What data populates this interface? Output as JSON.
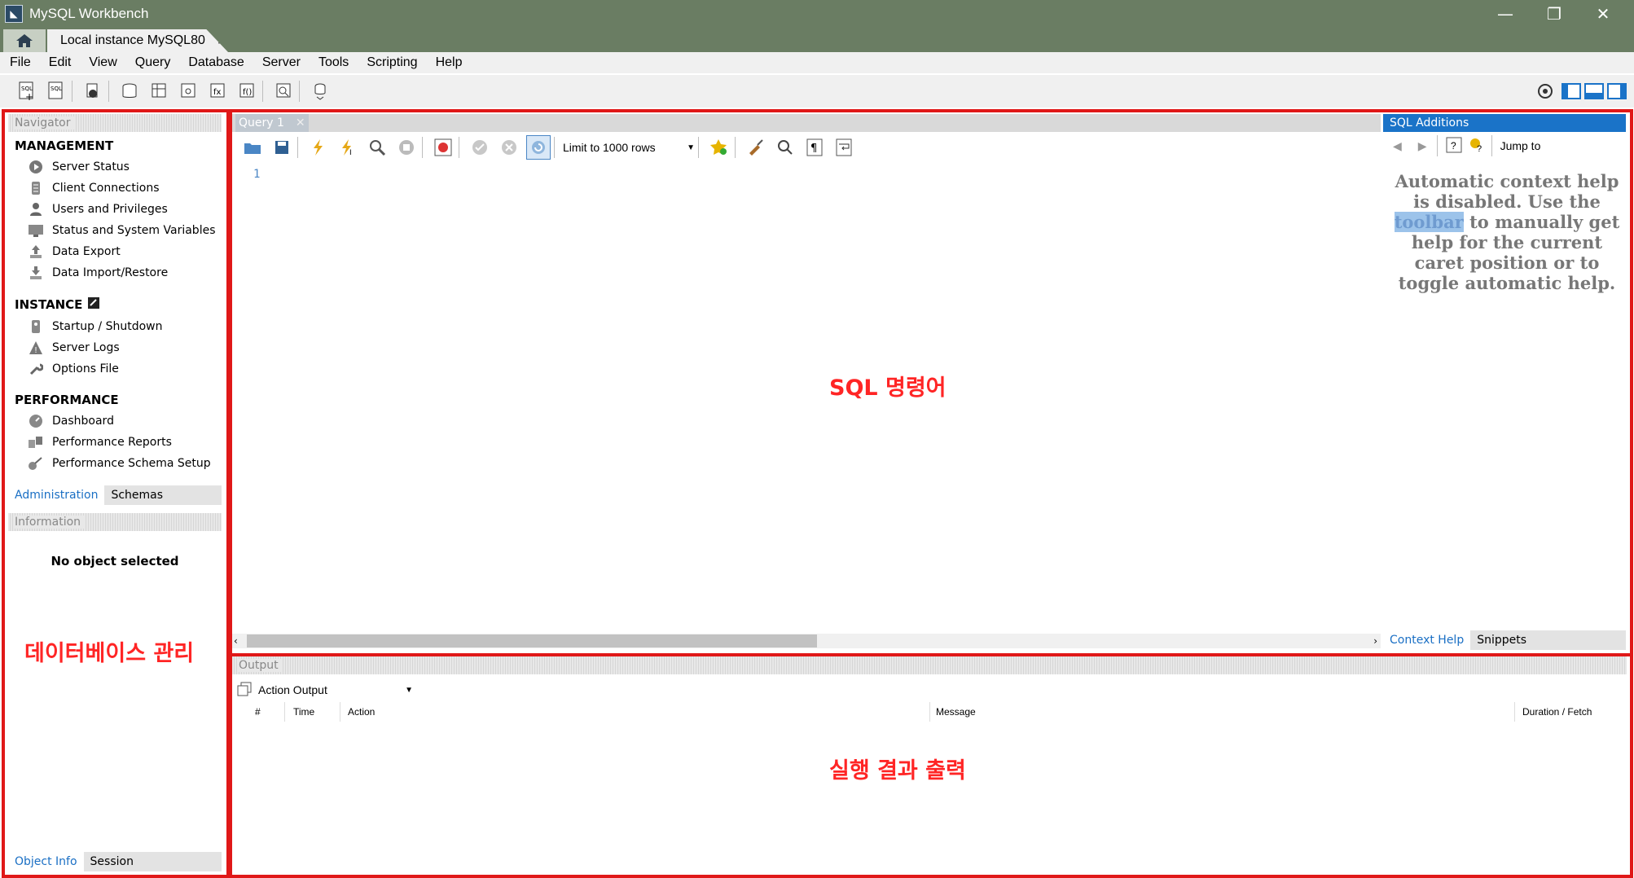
{
  "window": {
    "title": "MySQL Workbench",
    "tab_label": "Local instance MySQL80"
  },
  "menu": [
    "File",
    "Edit",
    "View",
    "Query",
    "Database",
    "Server",
    "Tools",
    "Scripting",
    "Help"
  ],
  "navigator": {
    "header": "Navigator",
    "management": {
      "title": "MANAGEMENT",
      "items": [
        "Server Status",
        "Client Connections",
        "Users and Privileges",
        "Status and System Variables",
        "Data Export",
        "Data Import/Restore"
      ]
    },
    "instance": {
      "title": "INSTANCE",
      "items": [
        "Startup / Shutdown",
        "Server Logs",
        "Options File"
      ]
    },
    "performance": {
      "title": "PERFORMANCE",
      "items": [
        "Dashboard",
        "Performance Reports",
        "Performance Schema Setup"
      ]
    },
    "tabs": [
      "Administration",
      "Schemas"
    ],
    "info_header": "Information",
    "no_object": "No object selected",
    "bottom_tabs": [
      "Object Info",
      "Session"
    ]
  },
  "query": {
    "tab": "Query 1",
    "limit": "Limit to 1000 rows",
    "line_no": "1"
  },
  "sql_additions": {
    "header": "SQL Additions",
    "jump_to": "Jump to",
    "help_before": "Automatic context help is disabled. Use the ",
    "help_mark": "toolbar",
    "help_after": " to manually get help for the current caret position or to toggle automatic help.",
    "tabs": [
      "Context Help",
      "Snippets"
    ]
  },
  "output": {
    "header": "Output",
    "selector": "Action Output",
    "columns": [
      "#",
      "Time",
      "Action",
      "Message",
      "Duration / Fetch"
    ]
  },
  "annotations": {
    "left": "데이터베이스 관리",
    "center": "SQL 명령어",
    "bottom": "실행 결과 출력"
  }
}
